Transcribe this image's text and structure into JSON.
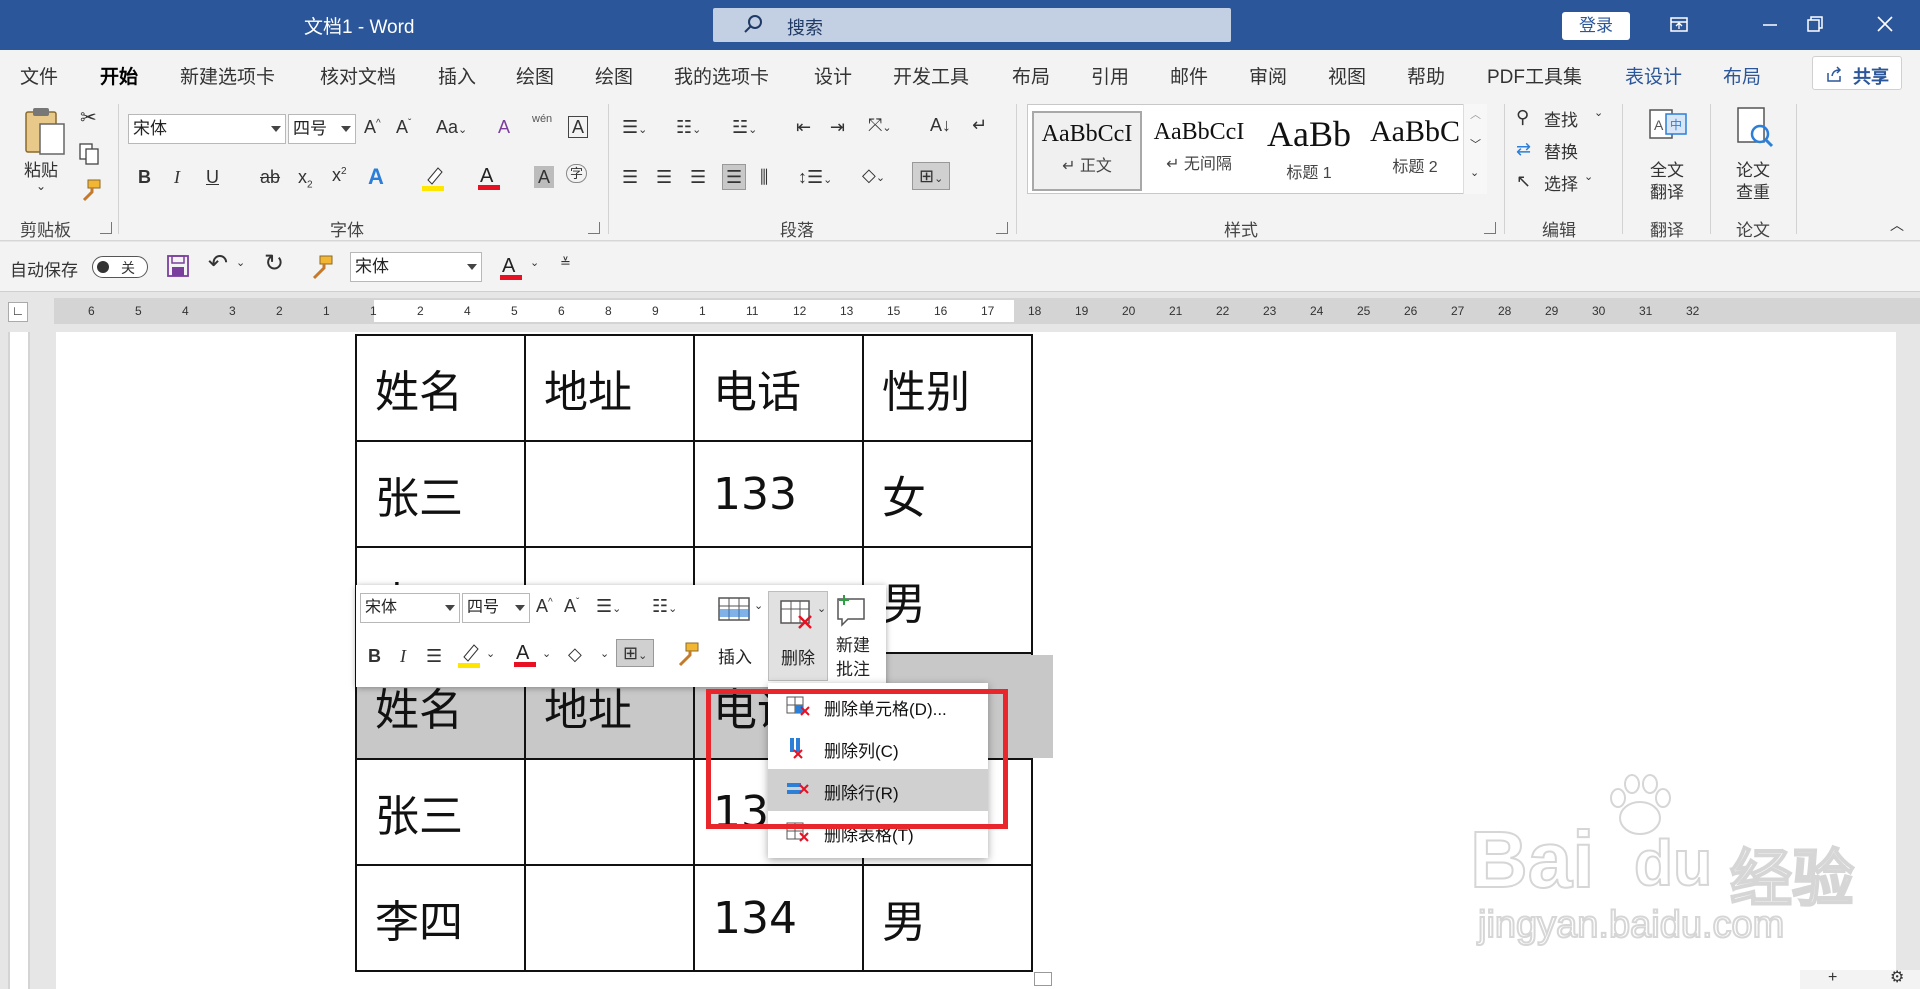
{
  "titlebar": {
    "doc_title": "文档1  -  Word",
    "search_placeholder": "搜索",
    "login": "登录"
  },
  "menu": {
    "tabs": [
      "文件",
      "开始",
      "新建选项卡",
      "核对文档",
      "插入",
      "绘图",
      "绘图",
      "我的选项卡",
      "设计",
      "开发工具",
      "布局",
      "引用",
      "邮件",
      "审阅",
      "视图",
      "帮助",
      "PDF工具集",
      "表设计",
      "布局"
    ],
    "active_index": 1,
    "share": "共享"
  },
  "ribbon": {
    "clipboard": {
      "paste": "粘贴",
      "label": "剪贴板"
    },
    "font": {
      "name": "宋体",
      "size": "四号",
      "label": "字体",
      "case_btn": "Aa",
      "phonetic": "wén"
    },
    "paragraph": {
      "label": "段落"
    },
    "styles": {
      "label": "样式",
      "items": [
        {
          "sample": "AaBbCcI",
          "name": "↵ 正文"
        },
        {
          "sample": "AaBbCcI",
          "name": "↵ 无间隔"
        },
        {
          "sample": "AaBb",
          "name": "标题 1"
        },
        {
          "sample": "AaBbC",
          "name": "标题 2"
        }
      ]
    },
    "editing": {
      "find": "查找",
      "replace": "替换",
      "select": "选择",
      "label": "编辑"
    },
    "translate": {
      "btn_line1": "全文",
      "btn_line2": "翻译",
      "label": "翻译"
    },
    "paper": {
      "btn_line1": "论文",
      "btn_line2": "查重",
      "label": "论文"
    }
  },
  "qat": {
    "autosave": "自动保存",
    "toggle": "关",
    "font": "宋体"
  },
  "ruler": {
    "numbers": [
      "6",
      "5",
      "4",
      "3",
      "2",
      "1",
      "1",
      "2",
      "4",
      "5",
      "6",
      "8",
      "9",
      "1",
      "11",
      "12",
      "13",
      "15",
      "16",
      "17",
      "18",
      "19",
      "20",
      "21",
      "22",
      "23",
      "24",
      "25",
      "26",
      "27",
      "28",
      "29",
      "30",
      "31",
      "32"
    ]
  },
  "table": {
    "rows": [
      [
        "姓名",
        "地址",
        "电话",
        "性别"
      ],
      [
        "张三",
        "",
        "133",
        "女"
      ],
      [
        "李四",
        "",
        "",
        "男"
      ],
      [
        "姓名",
        "地址",
        "电话",
        ""
      ],
      [
        "张三",
        "",
        "133",
        ""
      ],
      [
        "李四",
        "",
        "134",
        "男"
      ]
    ],
    "selected_row": 3
  },
  "minibar": {
    "font": "宋体",
    "size": "四号",
    "insert": "插入",
    "delete": "删除",
    "new_comment_l1": "新建",
    "new_comment_l2": "批注"
  },
  "delete_menu": {
    "items": [
      {
        "label": "删除单元格(D)...",
        "icon": "delete-cells-icon"
      },
      {
        "label": "删除列(C)",
        "icon": "delete-column-icon"
      },
      {
        "label": "删除行(R)",
        "icon": "delete-row-icon"
      },
      {
        "label": "删除表格(T)",
        "icon": "delete-table-icon"
      }
    ],
    "highlighted_index": 2
  },
  "watermark": {
    "brand": "Bai",
    "brand2": "du",
    "brand_cn": "经验",
    "url": "jingyan.baidu.com"
  },
  "colors": {
    "titlebar": "#2b579a",
    "accent": "#2b579a",
    "highlight_box": "#e8262b",
    "selection": "#c8c8c8",
    "font_color_red": "#e81123",
    "highlighter_yellow": "#ffe600"
  }
}
